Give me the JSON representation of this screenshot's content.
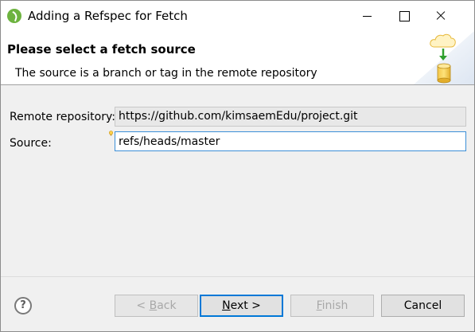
{
  "window": {
    "title": "Adding a Refspec for Fetch"
  },
  "banner": {
    "title": "Please select a fetch source",
    "description": "The source is a branch or tag in the remote repository"
  },
  "form": {
    "remote_label": "Remote repository:",
    "remote_value": "https://github.com/kimsaemEdu/project.git",
    "source_label": "Source:",
    "source_value": "refs/heads/master"
  },
  "buttons": {
    "help": "?",
    "back_prefix": "< ",
    "back_mnemonic": "B",
    "back_rest": "ack",
    "next_mnemonic": "N",
    "next_rest": "ext >",
    "finish_mnemonic": "F",
    "finish_rest": "inish",
    "cancel": "Cancel"
  },
  "icons": {
    "app": "eclipse-spring-icon",
    "banner": "cloud-fetch-database-icon",
    "required": "content-assist-bulb-icon",
    "help": "help-icon"
  },
  "colors": {
    "accent": "#0078d7",
    "focus_border": "#3c8fd7",
    "spring_green": "#6db33f"
  }
}
